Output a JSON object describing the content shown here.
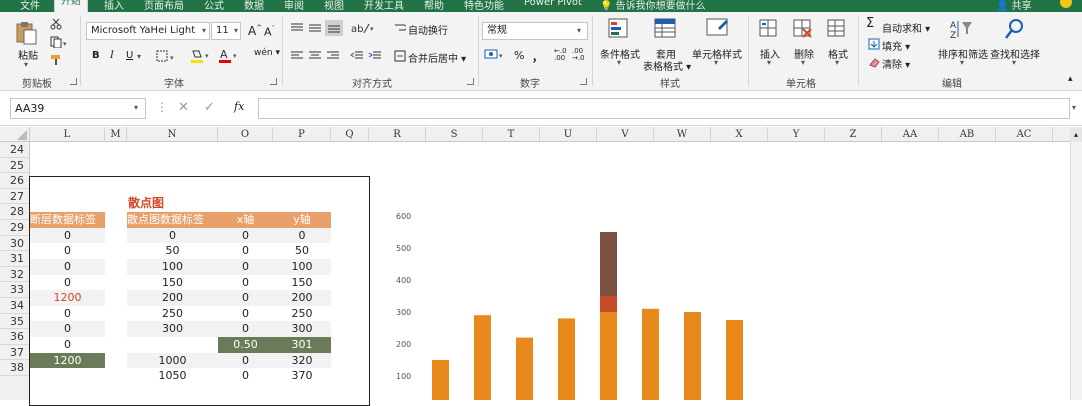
{
  "tabs": [
    {
      "label": "文件",
      "active": false
    },
    {
      "label": "开始",
      "active": true
    },
    {
      "label": "插入",
      "active": false
    },
    {
      "label": "页面布局",
      "active": false
    },
    {
      "label": "公式",
      "active": false
    },
    {
      "label": "数据",
      "active": false
    },
    {
      "label": "审阅",
      "active": false
    },
    {
      "label": "视图",
      "active": false
    },
    {
      "label": "开发工具",
      "active": false
    },
    {
      "label": "帮助",
      "active": false
    },
    {
      "label": "特色功能",
      "active": false
    },
    {
      "label": "Power Pivot",
      "active": false
    }
  ],
  "tellme": "告诉我你想要做什么",
  "share": "共享",
  "ribbon": {
    "clipboard": {
      "paste": "粘贴",
      "label": "剪贴板"
    },
    "font": {
      "name": "Microsoft YaHei Light",
      "size": "11",
      "bold": "B",
      "italic": "I",
      "underline": "U",
      "label": "字体",
      "grow": "A",
      "shrink": "A",
      "wen": "wén"
    },
    "alignment": {
      "wrap": "自动换行",
      "merge": "合并后居中",
      "label": "对齐方式"
    },
    "number": {
      "format": "常规",
      "percent": "%",
      "comma": "，",
      "inc": ".00",
      "dec": ".0",
      "label": "数字"
    },
    "styles": {
      "cond": "条件格式",
      "table": "套用",
      "table2": "表格格式",
      "cell": "单元格样式",
      "label": "样式"
    },
    "cells": {
      "insert": "插入",
      "delete": "删除",
      "format": "格式",
      "label": "单元格"
    },
    "editing": {
      "autosum": "自动求和",
      "fill": "填充",
      "clear": "清除",
      "sort": "排序和筛选",
      "find": "查找和选择",
      "label": "编辑"
    }
  },
  "namebox": "AA39",
  "fx": "fx",
  "columns": [
    "L",
    "M",
    "N",
    "O",
    "P",
    "Q",
    "R",
    "S",
    "T",
    "U",
    "V",
    "W",
    "X",
    "Y",
    "Z",
    "AA",
    "AB",
    "AC"
  ],
  "rows": [
    "24",
    "25",
    "26",
    "27",
    "28",
    "29",
    "30",
    "31",
    "32",
    "33",
    "34",
    "35",
    "36",
    "37",
    "38"
  ],
  "scatter_title": "散点图",
  "table_left": {
    "header": "断层数据标签",
    "values": [
      "0",
      "0",
      "0",
      "0",
      "1200",
      "0",
      "0",
      "0",
      "1200",
      ""
    ]
  },
  "table_right": {
    "headers": [
      "散点图数据标签",
      "x轴",
      "y轴"
    ],
    "rows": [
      [
        "0",
        "0",
        "0"
      ],
      [
        "50",
        "0",
        "50"
      ],
      [
        "100",
        "0",
        "100"
      ],
      [
        "150",
        "0",
        "150"
      ],
      [
        "200",
        "0",
        "200"
      ],
      [
        "250",
        "0",
        "250"
      ],
      [
        "300",
        "0",
        "300"
      ],
      [
        "",
        "0.50",
        "301"
      ],
      [
        "1000",
        "0",
        "320"
      ],
      [
        "1050",
        "0",
        "370"
      ]
    ]
  },
  "colors": {
    "accent": "#217346",
    "bar": "#e8891c",
    "bar_top": "#7a5040",
    "bar_mid": "#c44b2a",
    "header": "#e8a06a",
    "dark": "#6b7b5a"
  },
  "chart_data": {
    "type": "bar",
    "ylim": [
      0,
      600
    ],
    "yticks": [
      "600",
      "500",
      "400",
      "300",
      "200",
      "100"
    ],
    "values": [
      150,
      290,
      220,
      280,
      550,
      310,
      300,
      275
    ],
    "break_bar_index": 4,
    "break_segments": [
      300,
      50,
      200
    ]
  }
}
